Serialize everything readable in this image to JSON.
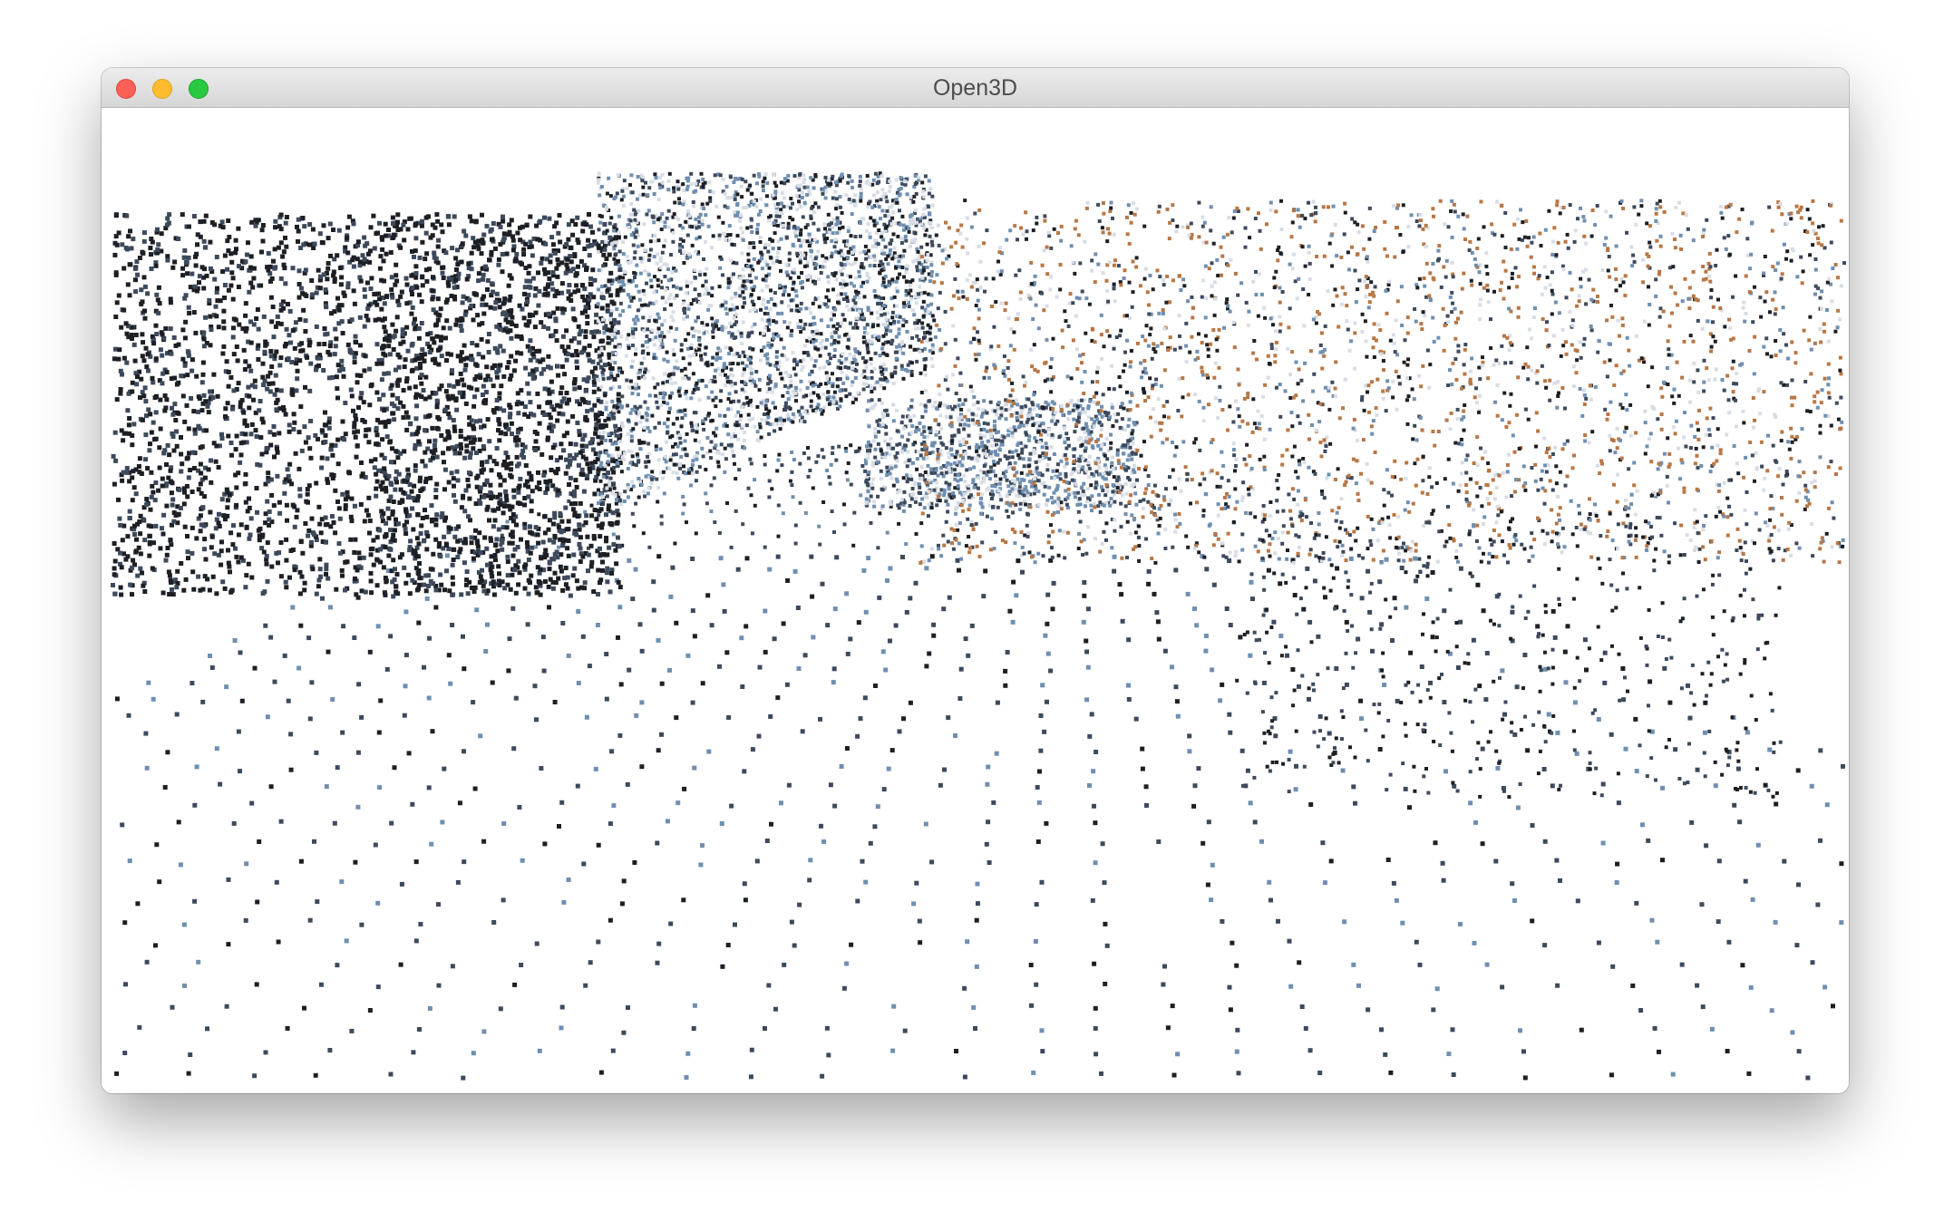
{
  "window": {
    "title": "Open3D",
    "buttons": [
      "close",
      "minimize",
      "zoom"
    ]
  },
  "viewport": {
    "content": "point-cloud",
    "background": "#ffffff"
  },
  "colors": {
    "close": "#fe5f57",
    "minimize": "#febc2e",
    "zoom": "#28c840",
    "point_dark": "#1c1f24",
    "point_slate": "#3d4a5c",
    "point_blue": "#6f8fb0",
    "point_autumn": "#b87745",
    "point_facade": "#d8dde5"
  }
}
